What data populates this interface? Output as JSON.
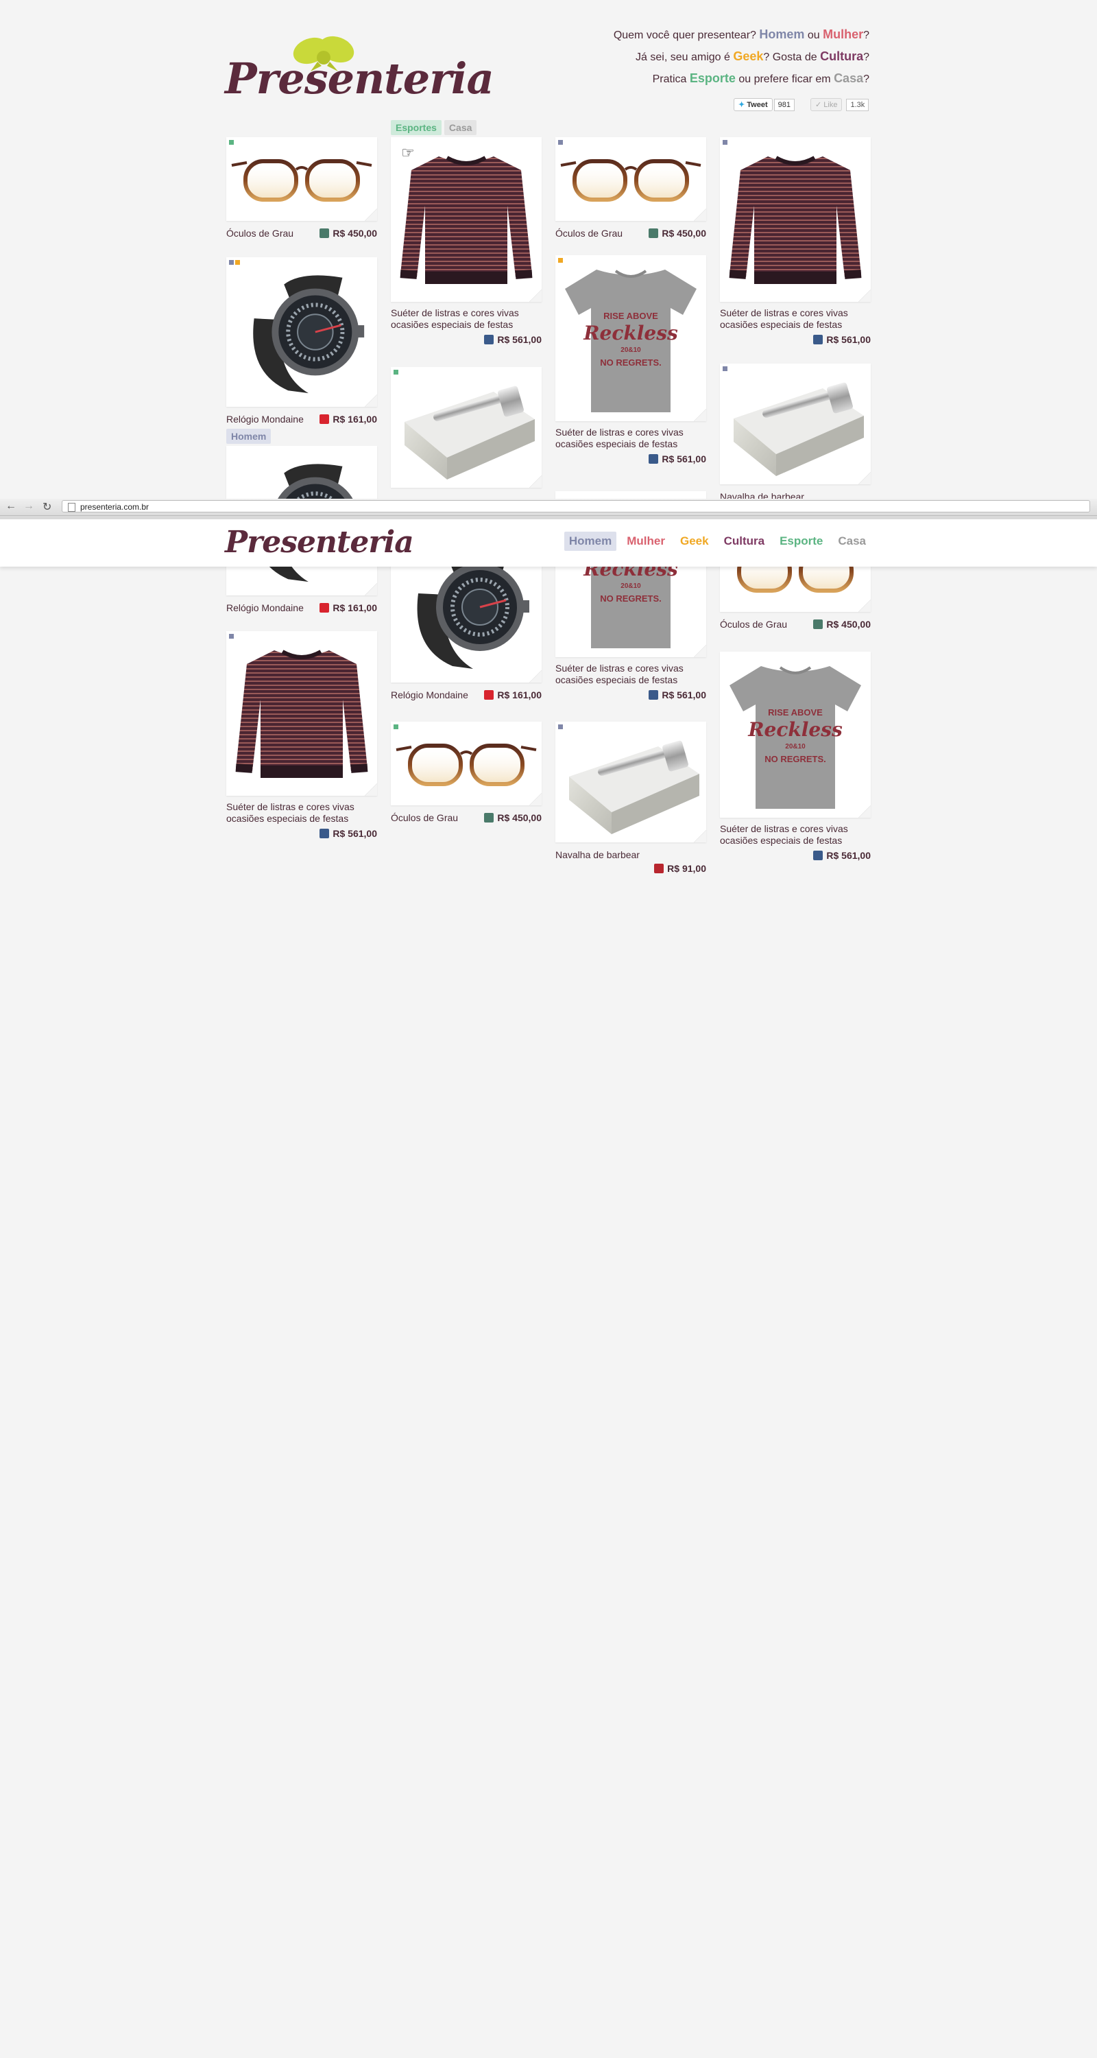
{
  "brand": {
    "name": "Presenteria"
  },
  "header": {
    "line1": {
      "prefix": "Quem você quer presentear? ",
      "homem": "Homem",
      "or": " ou ",
      "mulher": "Mulher",
      "suffix": "?"
    },
    "line2": {
      "prefix": "Já sei, seu amigo é ",
      "geek": "Geek",
      "mid": "? Gosta de ",
      "cultura": "Cultura",
      "suffix": "?"
    },
    "line3": {
      "prefix": "Pratica ",
      "esporte": "Esporte",
      "mid": " ou prefere ficar em ",
      "casa": "Casa",
      "suffix": "?"
    },
    "tweet_label": "Tweet",
    "tweet_count": "981",
    "like_label": "Like",
    "like_count": "1.3k"
  },
  "tags": {
    "esporte": "Esportes",
    "casa": "Casa",
    "homem": "Homem"
  },
  "browser": {
    "url": "presenteria.com.br"
  },
  "sticky_nav": [
    "Homem",
    "Mulher",
    "Geek",
    "Cultura",
    "Esporte",
    "Casa"
  ],
  "products": {
    "glasses": {
      "name": "Óculos de Grau",
      "price": "R$ 450,00"
    },
    "sweater": {
      "name": "Suéter de listras e cores vivas ocasiões especiais de festas",
      "price": "R$ 561,00"
    },
    "watch": {
      "name": "Relógio Mondaine",
      "price": "R$ 161,00"
    },
    "razor": {
      "name": "Navalha de barbear",
      "price": "R$ 91,00"
    }
  },
  "colors": {
    "homem": "#7f86a8",
    "mulher": "#d9626f",
    "geek": "#f0a824",
    "cultura": "#7e3a63",
    "esporte": "#5bb482",
    "casa": "#9a9a9a"
  }
}
